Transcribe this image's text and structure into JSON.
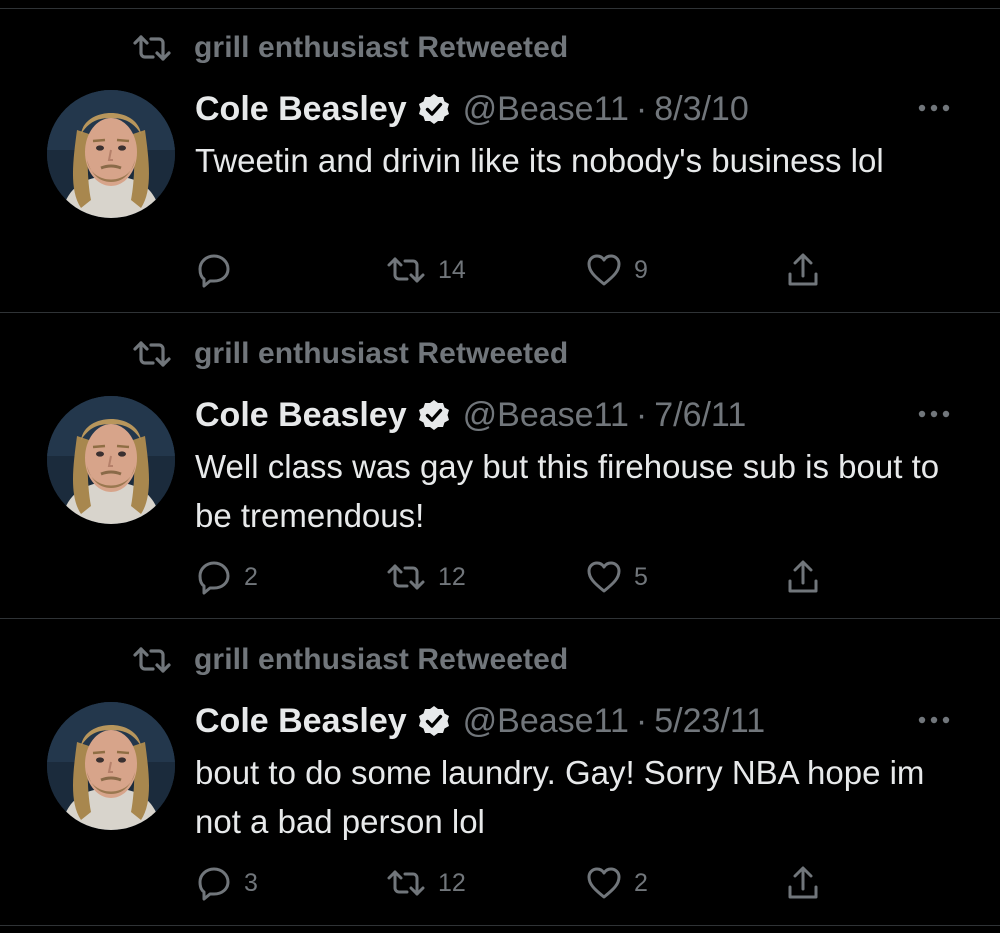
{
  "colors": {
    "background": "#000000",
    "text_primary": "#e7e9ea",
    "text_secondary": "#71767b",
    "divider": "#2f3336"
  },
  "icons": {
    "retweeted": "retweet-icon",
    "verified": "verified-badge-icon",
    "more": "more-options-icon",
    "reply": "reply-icon",
    "retweet": "retweet-icon",
    "like": "heart-icon",
    "share": "share-icon"
  },
  "tweets": [
    {
      "retweeted_by": "grill enthusiast Retweeted",
      "name": "Cole Beasley",
      "handle": "@Bease11",
      "separator": "·",
      "date": "8/3/10",
      "text": "Tweetin and drivin like its nobody's business lol",
      "replies": "",
      "retweets": "14",
      "likes": "9"
    },
    {
      "retweeted_by": "grill enthusiast Retweeted",
      "name": "Cole Beasley",
      "handle": "@Bease11",
      "separator": "·",
      "date": "7/6/11",
      "text": "Well class was gay but this firehouse sub is bout to be tremendous!",
      "replies": "2",
      "retweets": "12",
      "likes": "5"
    },
    {
      "retweeted_by": "grill enthusiast Retweeted",
      "name": "Cole Beasley",
      "handle": "@Bease11",
      "separator": "·",
      "date": "5/23/11",
      "text": "bout to do some laundry. Gay! Sorry NBA hope im not a bad person lol",
      "replies": "3",
      "retweets": "12",
      "likes": "2"
    }
  ]
}
